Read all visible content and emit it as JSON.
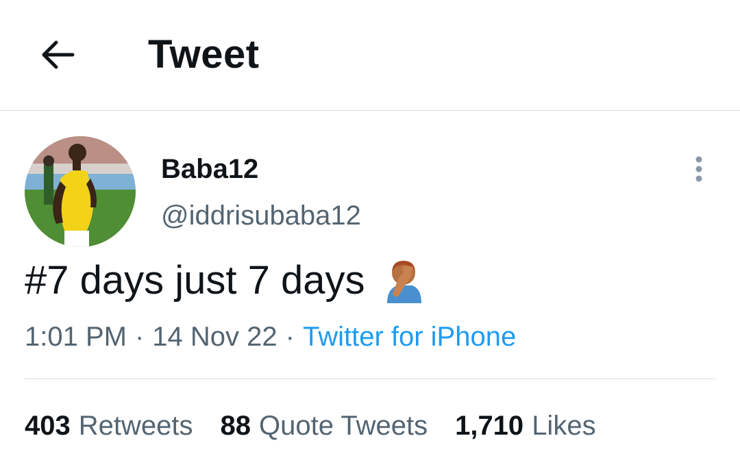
{
  "header": {
    "title": "Tweet",
    "back_icon": "arrow-left-icon"
  },
  "author": {
    "display_name": "Baba12",
    "handle": "@iddrisubaba12",
    "more_icon": "more-vertical-icon"
  },
  "tweet": {
    "text": "#7 days just 7 days",
    "emoji": "person-facepalming-emoji"
  },
  "meta": {
    "time": "1:01 PM",
    "separator": "·",
    "date": "14 Nov 22",
    "source": "Twitter for iPhone"
  },
  "stats": [
    {
      "count": "403",
      "label": "Retweets"
    },
    {
      "count": "88",
      "label": "Quote Tweets"
    },
    {
      "count": "1,710",
      "label": "Likes"
    }
  ],
  "colors": {
    "text": "#0f1419",
    "secondary": "#536471",
    "link": "#1d9bf0",
    "divider": "#d7dbdf"
  }
}
